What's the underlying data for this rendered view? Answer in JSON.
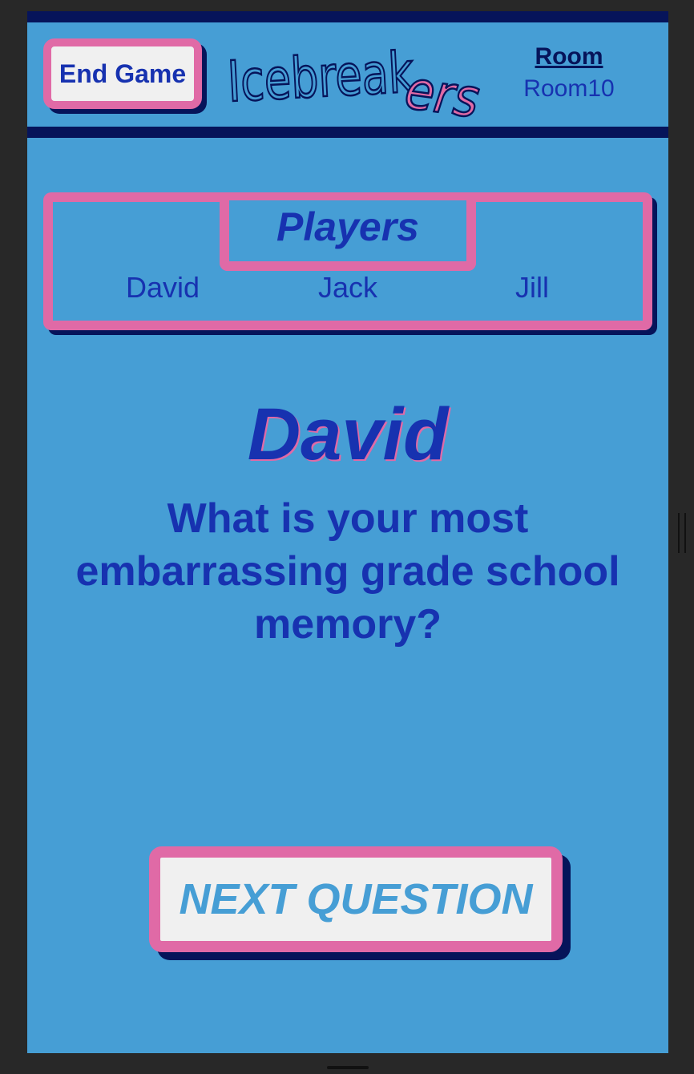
{
  "header": {
    "end_game_label": "End Game",
    "logo_part1": "Icebreak",
    "logo_part2": "ers",
    "room_label": "Room",
    "room_value": "Room10"
  },
  "players": {
    "title": "Players",
    "names": [
      "David",
      "Jack",
      "Jill"
    ]
  },
  "current_turn": {
    "player": "David",
    "question": "What is your most embarrassing grade school memory?"
  },
  "actions": {
    "next_question_label": "NEXT QUESTION"
  },
  "colors": {
    "background": "#469ed5",
    "accent_pink": "#e06aa6",
    "navy": "#06145a",
    "text_blue": "#1732b0",
    "button_bg": "#f0f0f0"
  }
}
